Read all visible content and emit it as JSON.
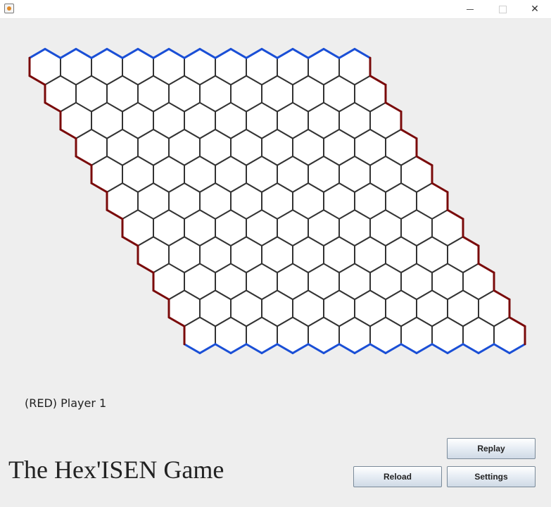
{
  "window": {
    "buttons": [
      "minimize",
      "maximize",
      "close"
    ],
    "close_glyph": "✕"
  },
  "board": {
    "size": 11,
    "cells": "all-empty",
    "cell_color": "#ffffff",
    "cell_border_color": "#333333",
    "red_edge_color": "#7a0a0a",
    "blue_edge_color": "#1a4fd6"
  },
  "status": {
    "text": "(RED) Player 1"
  },
  "footer": {
    "title": "The Hex'ISEN Game"
  },
  "buttons": {
    "replay": "Replay",
    "reload": "Reload",
    "settings": "Settings"
  }
}
